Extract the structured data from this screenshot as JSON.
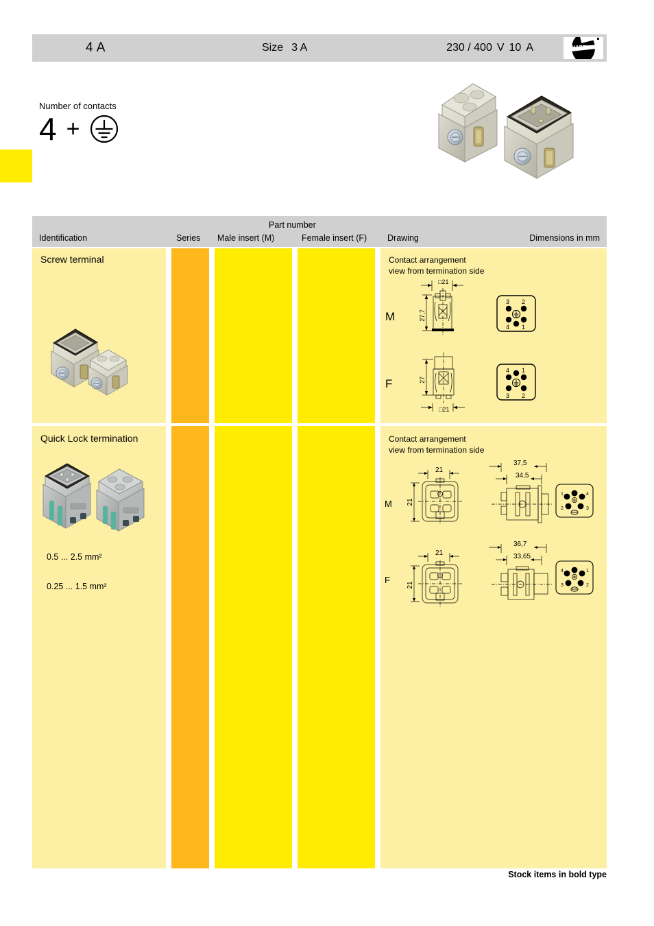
{
  "header": {
    "left_code": "4 A",
    "size_label": "Size",
    "size_value": "3 A",
    "voltage": "230 / 400",
    "voltage_unit": "V",
    "current": "10",
    "current_unit": "A",
    "logo_text": "HARTING"
  },
  "contacts": {
    "label": "Number of contacts",
    "count": "4",
    "plus": "+",
    "earth_symbol_name": "protective-earth-symbol"
  },
  "table": {
    "headers": {
      "identification": "Identification",
      "series": "Series",
      "part_number": "Part number",
      "male_insert": "Male insert (M)",
      "female_insert": "Female insert (F)",
      "drawing": "Drawing",
      "dimensions": "Dimensions in mm"
    },
    "colors": {
      "identification_band": "#fdf0a4",
      "series_band": "#ffb81c",
      "part_number_band": "#ffec00",
      "drawing_band": "#fdf0a4",
      "header_band": "#d0d0d0",
      "side_tab": "#ffec00"
    },
    "rows": [
      {
        "title": "Screw terminal",
        "series": "",
        "male_part": "",
        "female_part": "",
        "drawing_caption_line1": "Contact arrangement",
        "drawing_caption_line2": "view from termination side",
        "views": [
          {
            "label": "M",
            "width_dim": "□21",
            "height_dim": "27,7",
            "contact_numbers": [
              "3",
              "2",
              "4",
              "1"
            ]
          },
          {
            "label": "F",
            "width_dim": "□21",
            "height_dim": "27",
            "contact_numbers": [
              "4",
              "1",
              "3",
              "2"
            ]
          }
        ]
      },
      {
        "title": "Quick Lock termination",
        "series": "",
        "male_part": "",
        "female_part": "",
        "wire_range_1": "0.5 ... 2.5 mm²",
        "wire_range_2": "0.25 ... 1.5 mm²",
        "drawing_caption_line1": "Contact arrangement",
        "drawing_caption_line2": "view from termination side",
        "views": [
          {
            "label": "M",
            "front_width": "21",
            "front_height": "21",
            "depth_outer": "37,5",
            "depth_inner": "34,5",
            "contact_numbers": [
              "1",
              "4",
              "2",
              "3"
            ]
          },
          {
            "label": "F",
            "front_width": "21",
            "front_height": "21",
            "depth_outer": "36,7",
            "depth_inner": "33,65",
            "contact_numbers": [
              "4",
              "1",
              "3",
              "2"
            ]
          }
        ]
      }
    ]
  },
  "footer": {
    "note": "Stock items in bold type"
  }
}
